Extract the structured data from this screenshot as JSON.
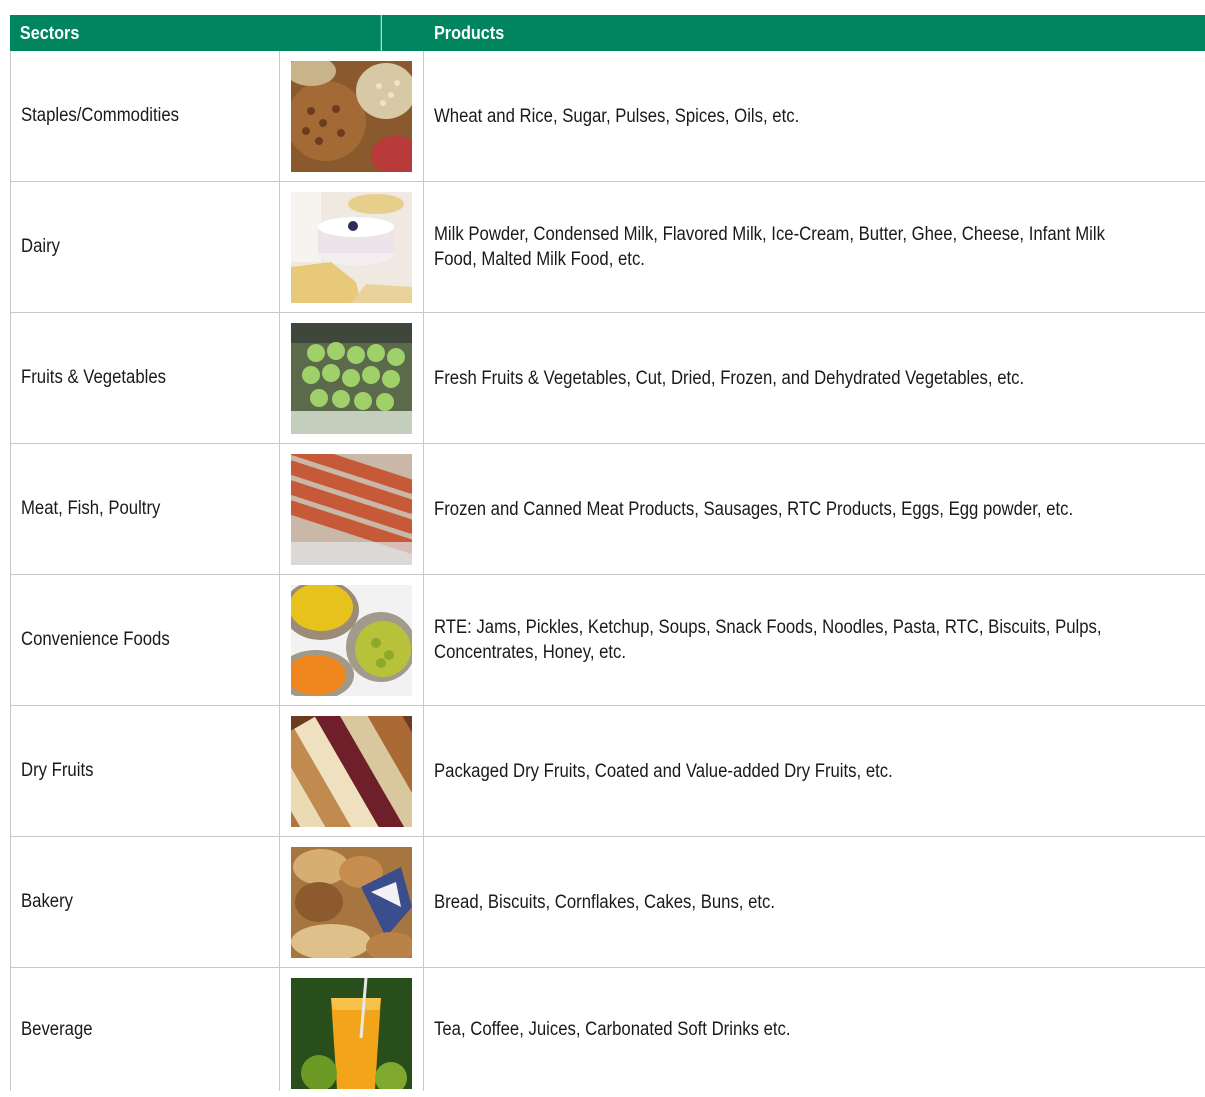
{
  "table": {
    "header": {
      "sectors": "Sectors",
      "products": "Products"
    },
    "rows": [
      {
        "sector": "Staples/Commodities",
        "products": "Wheat and Rice, Sugar, Pulses, Spices, Oils, etc.",
        "image": "staples-photo"
      },
      {
        "sector": "Dairy",
        "products": "Milk Powder, Condensed Milk, Flavored Milk, Ice-Cream, Butter, Ghee, Cheese, Infant Milk Food, Malted Milk Food, etc.",
        "image": "dairy-photo"
      },
      {
        "sector": "Fruits & Vegetables",
        "products": "Fresh Fruits & Vegetables, Cut, Dried, Frozen, and Dehydrated Vegetables, etc.",
        "image": "fruits-vegetables-photo"
      },
      {
        "sector": "Meat, Fish, Poultry",
        "products": "Frozen and Canned Meat Products, Sausages, RTC Products, Eggs, Egg powder, etc.",
        "image": "meat-photo"
      },
      {
        "sector": "Convenience Foods",
        "products": "RTE: Jams, Pickles, Ketchup, Soups, Snack Foods, Noodles, Pasta, RTC, Biscuits, Pulps, Concentrates, Honey, etc.",
        "image": "convenience-foods-photo"
      },
      {
        "sector": "Dry Fruits",
        "products": "Packaged Dry Fruits, Coated and Value-added Dry Fruits, etc.",
        "image": "dry-fruits-photo"
      },
      {
        "sector": "Bakery",
        "products": "Bread, Biscuits, Cornflakes, Cakes, Buns, etc.",
        "image": "bakery-photo"
      },
      {
        "sector": "Beverage",
        "products": "Tea, Coffee, Juices, Carbonated Soft Drinks etc.",
        "image": "beverage-photo"
      }
    ]
  },
  "colors": {
    "header_bg": "#00855e",
    "header_text": "#ffffff",
    "grid": "#c8c8c8"
  }
}
